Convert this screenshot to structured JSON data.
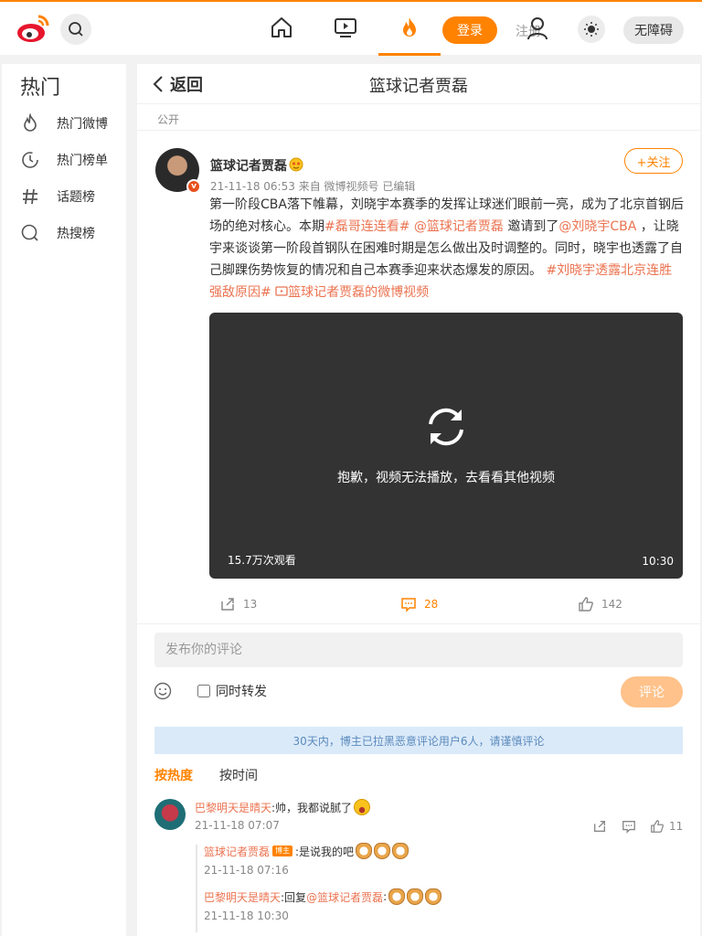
{
  "header": {
    "login": "登录",
    "register": "注册",
    "accessibility": "无障碍"
  },
  "sidebar": {
    "title": "热门",
    "items": [
      {
        "label": "热门微博",
        "icon": "flame-icon"
      },
      {
        "label": "热门榜单",
        "icon": "clock-icon"
      },
      {
        "label": "话题榜",
        "icon": "hash-icon"
      },
      {
        "label": "热搜榜",
        "icon": "search-circle-icon"
      }
    ]
  },
  "main": {
    "back_label": "返回",
    "title": "篮球记者贾磊",
    "visibility": "公开"
  },
  "post": {
    "author": "篮球记者贾磊",
    "time": "21-11-18 06:53",
    "source": "来自 微博视频号",
    "edited": "已编辑",
    "follow_label": "+关注",
    "text": {
      "p1": "第一阶段CBA落下帷幕，刘晓宇本赛季的发挥让球迷们眼前一亮，成为了北京首钢后场的绝对核心。本期",
      "tag1": "#磊哥连连看#",
      "mention1": "@篮球记者贾磊",
      "p2": "邀请到了",
      "mention2": "@刘晓宇CBA",
      "p3": "，让晓宇来谈谈第一阶段首钢队在困难时期是怎么做出及时调整的。同时，晓宇也透露了自己脚踝伤势恢复的情况和自己本赛季迎来状态爆发的原因。",
      "tag2": "#刘晓宇透露北京连胜强敌原因#",
      "video_link": "篮球记者贾磊的微博视频"
    },
    "video": {
      "error": "抱歉，视频无法播放，去看看其他视频",
      "views": "15.7万次观看",
      "duration": "10:30"
    },
    "actions": {
      "reposts": "13",
      "comments": "28",
      "likes": "142"
    }
  },
  "comment_box": {
    "placeholder": "发布你的评论",
    "repost_label": "同时转发",
    "submit": "评论",
    "notice": "30天内，博主已拉黑恶意评论用户6人，请谨慎评论",
    "sort_hot": "按热度",
    "sort_time": "按时间"
  },
  "comments": [
    {
      "user": "巴黎明天是晴天",
      "text": ":帅，我都说腻了",
      "time": "21-11-18 07:07",
      "likes": "11",
      "replies": [
        {
          "user": "篮球记者贾磊",
          "badge": "博主",
          "text": ":是说我的吧",
          "time": "21-11-18 07:16"
        },
        {
          "user": "巴黎明天是晴天",
          "text": ":回复",
          "mention": "@篮球记者贾磊",
          "text2": ":",
          "time": "21-11-18 10:30"
        }
      ]
    }
  ],
  "colors": {
    "accent": "#ff8200",
    "link": "#eb7350"
  }
}
